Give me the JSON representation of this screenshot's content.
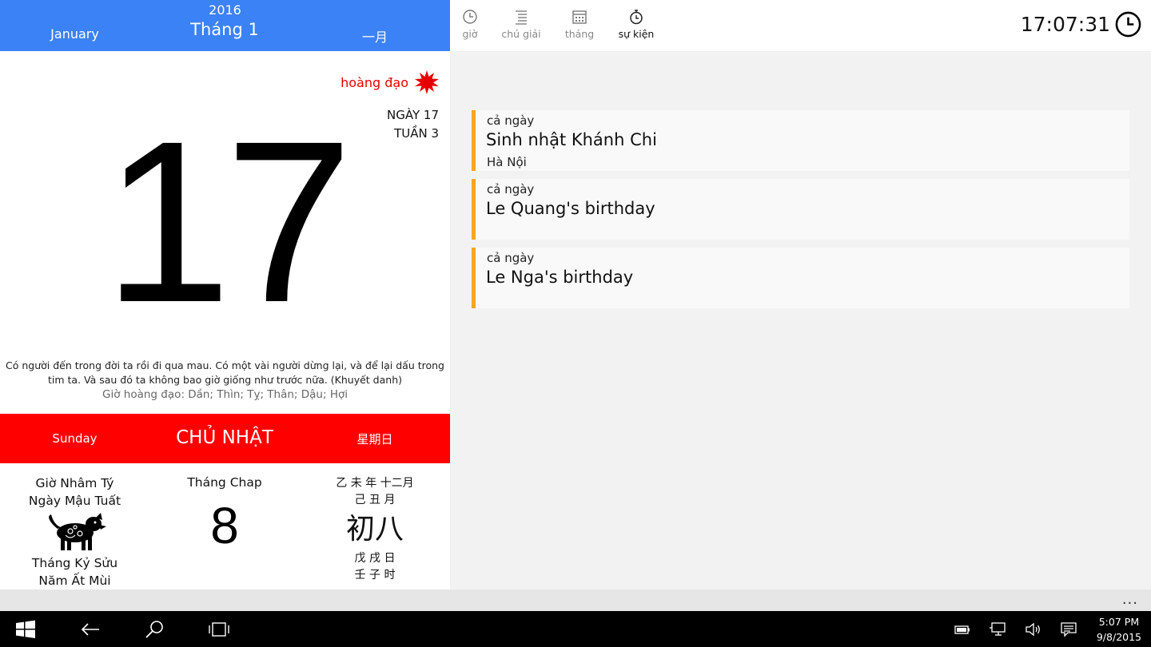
{
  "month_header": {
    "year": "2016",
    "english": "January",
    "vietnamese": "Tháng 1",
    "chinese": "一月"
  },
  "lucky_label": "hoàng đạo",
  "day_info": {
    "day_of_year": "NGÀY 17",
    "week": "TUẦN 3"
  },
  "big_day": "17",
  "quote": "Có người đến trong đời ta rồi đi qua mau. Có một vài người dừng lại, và để lại dấu trong tim ta. Và sau đó ta không bao giờ giống như trước nữa. (Khuyết danh)",
  "lucky_hours": "Giờ hoàng đạo: Dần; Thìn; Tỵ; Thân; Dậu; Hợi",
  "weekday": {
    "english": "Sunday",
    "vietnamese": "CHỦ NHẬT",
    "chinese": "星期日"
  },
  "lunar": {
    "hour": "Giờ Nhâm Tý",
    "day": "Ngày Mậu Tuất",
    "month_can_chi": "Tháng Kỷ Sửu",
    "year": "Năm Ất Mùi",
    "month_name": "Tháng Chap",
    "day_number": "8",
    "zh_year_month": "乙 未 年   十二月",
    "zh_month": "己 丑 月",
    "zh_day_big": "初八",
    "zh_day": "戊 戌 日",
    "zh_hour": "壬 子 时"
  },
  "nav": {
    "tabs": [
      {
        "label": "giờ",
        "icon": "clock-icon"
      },
      {
        "label": "chú giải",
        "icon": "list-icon"
      },
      {
        "label": "tháng",
        "icon": "calendar-icon"
      },
      {
        "label": "sự kiện",
        "icon": "stopwatch-icon"
      }
    ],
    "active": "sự kiện"
  },
  "clock_time": "17:07:31",
  "events": [
    {
      "when": "cả ngày",
      "title": "Sinh nhật Khánh Chi",
      "location": "Hà Nội"
    },
    {
      "when": "cả ngày",
      "title": "Le Quang's birthday",
      "location": ""
    },
    {
      "when": "cả ngày",
      "title": "Le Nga's birthday",
      "location": ""
    }
  ],
  "appbar_more": "...",
  "taskbar": {
    "time": "5:07 PM",
    "date": "9/8/2015"
  },
  "colors": {
    "month_bar": "#3b82f6",
    "weekday_bar": "#ff0000",
    "event_accent": "#f5a623",
    "lucky_red": "#e60000"
  }
}
